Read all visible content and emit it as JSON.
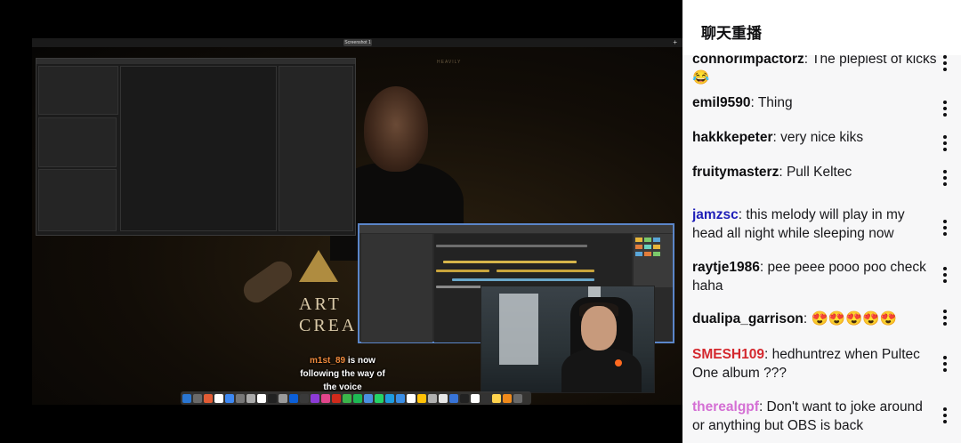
{
  "stream": {
    "desktop_tab_label": "Screenshot 1",
    "desktop_plus": "+",
    "wallpaper_word": "HEAVILY",
    "brand_text_lines": "ART\nCREA",
    "follow_alert": {
      "username": "m1st_89",
      "line1_rest": " is now",
      "line2": "following the way of",
      "line3": "the voice"
    },
    "dock_colors": [
      "#2a76d2",
      "#6a6a6a",
      "#e25c35",
      "#ffffff",
      "#3d88f2",
      "#777777",
      "#aaaaaa",
      "#ffffff",
      "#222222",
      "#9a9a9a",
      "#0b5fd8",
      "#3a3a3a",
      "#8c3bd6",
      "#e1458b",
      "#d02a1b",
      "#3bb54a",
      "#1db954",
      "#4a90e2",
      "#25d366",
      "#1e9be0",
      "#3a8ee6",
      "#ffffff",
      "#ffc107",
      "#b0b0b0",
      "#e6e6e6",
      "#3874d8",
      "#222222",
      "#ffffff",
      "#333333",
      "#ffd34d",
      "#ef8a1b",
      "#6a6a6a"
    ]
  },
  "chat": {
    "header_title": "聊天重播",
    "messages": [
      {
        "user": "connorimpactorz",
        "user_color": "#0e0e10",
        "text": " The plepiest of kicks 😂"
      },
      {
        "user": "emil9590",
        "user_color": "#0e0e10",
        "text": " Thing"
      },
      {
        "user": "hakkkepeter",
        "user_color": "#0e0e10",
        "text": " very nice kiks"
      },
      {
        "user": "fruitymasterz",
        "user_color": "#0e0e10",
        "text": " Pull Keltec"
      },
      {
        "user": "jamzsc",
        "user_color": "#1f1fb8",
        "text": " this melody will play in my head all night while sleeping now"
      },
      {
        "user": "raytje1986",
        "user_color": "#0e0e10",
        "text": " pee peee pooo poo check haha"
      },
      {
        "user": "dualipa_garrison",
        "user_color": "#0e0e10",
        "text": " 😍😍😍😍😍"
      },
      {
        "user": "SMESH109",
        "user_color": "#d4282e",
        "text": " hedhuntrez when Pultec One album ???"
      },
      {
        "user": "therealgpf",
        "user_color": "#d46fd4",
        "text": " Don't want to joke around or anything but OBS is back"
      }
    ],
    "separator": ":",
    "more_icon": "vertical-ellipsis-icon"
  }
}
